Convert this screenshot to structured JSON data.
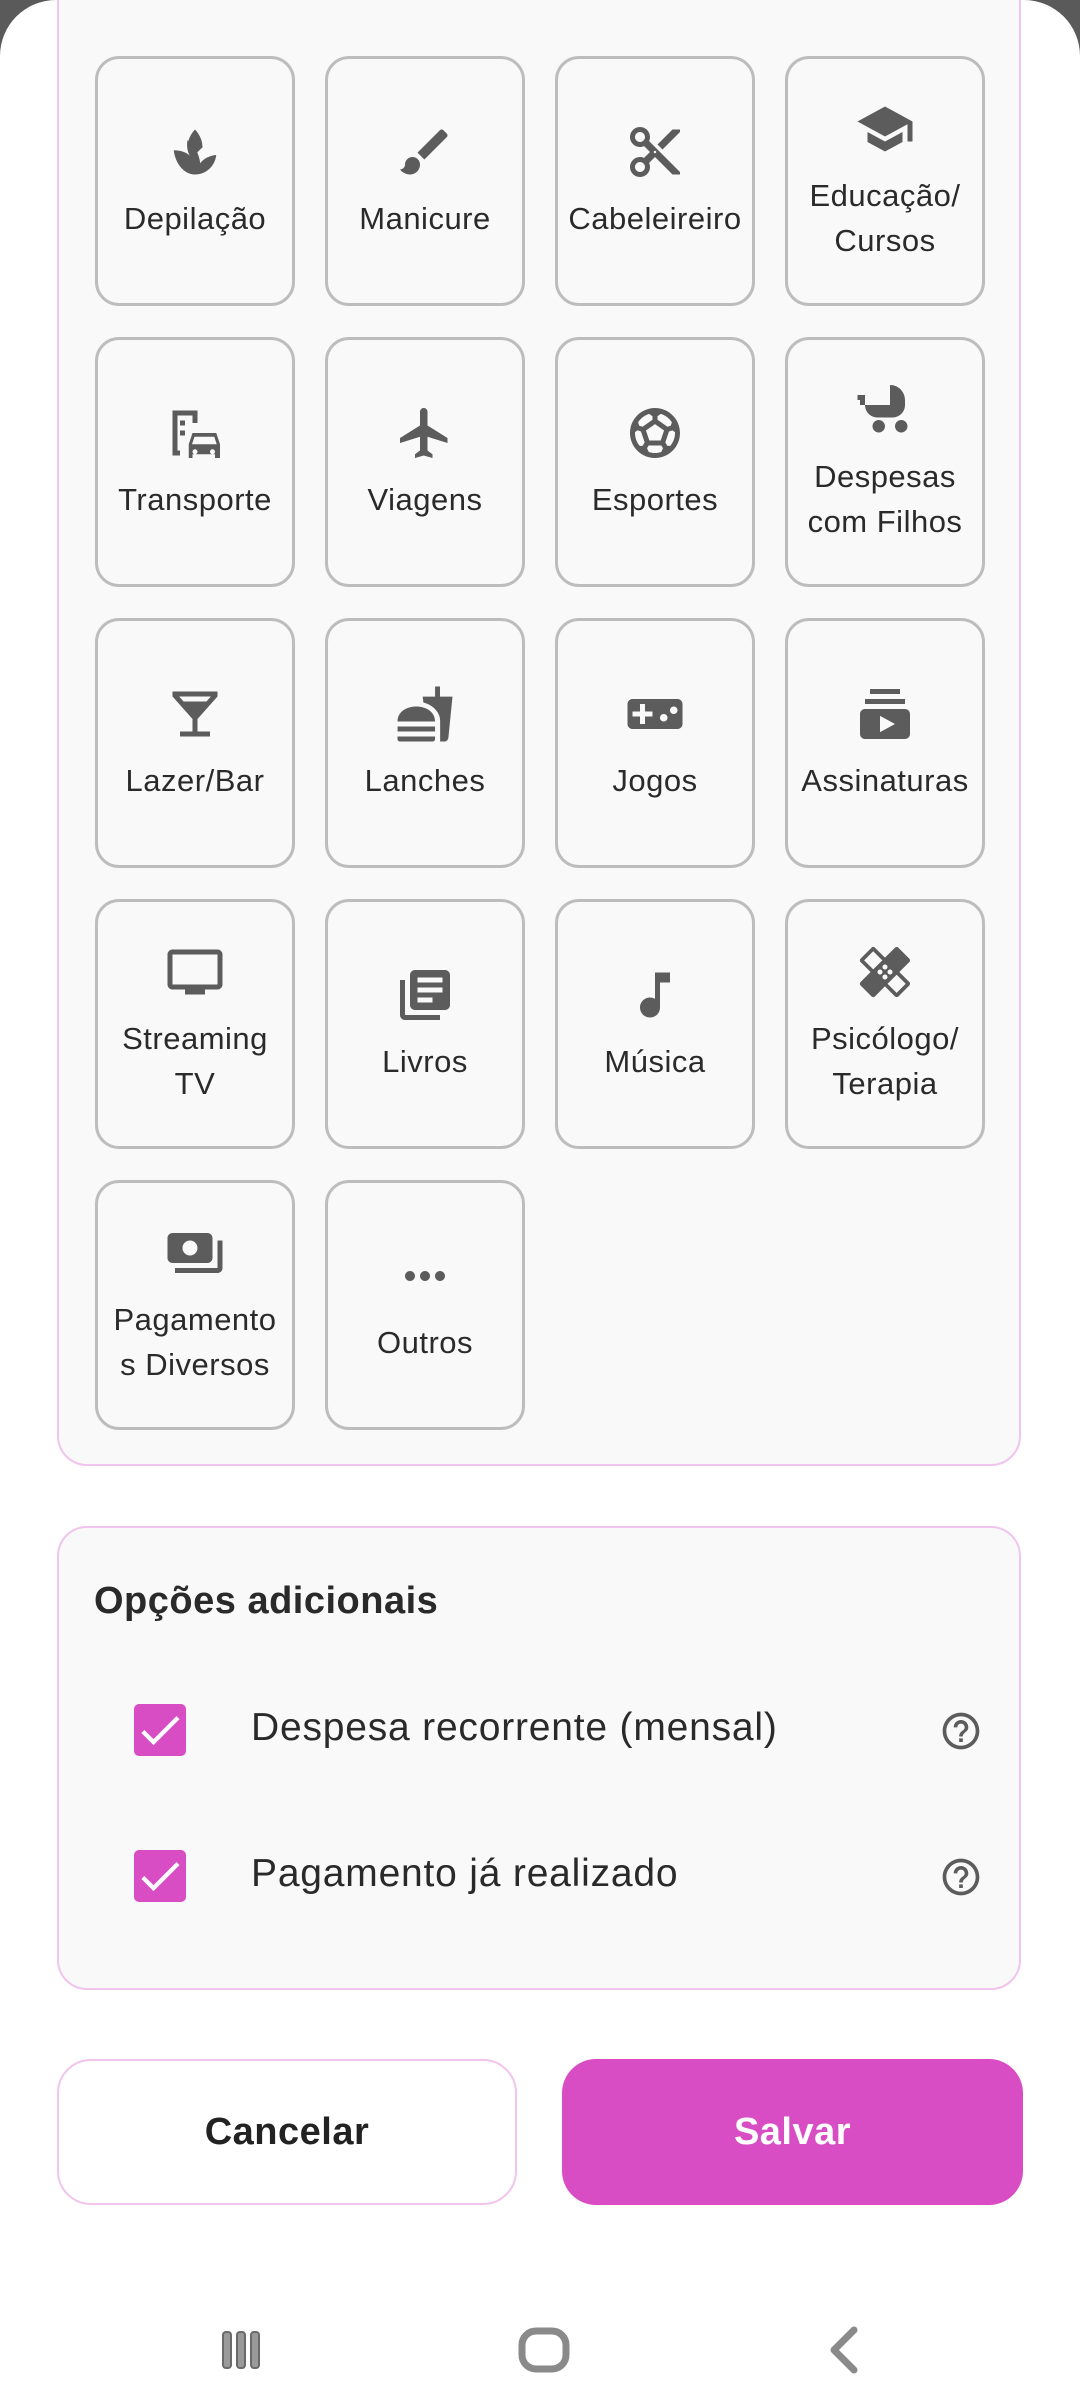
{
  "categories": [
    {
      "label": "Depilação",
      "icon": "spa-icon"
    },
    {
      "label": "Manicure",
      "icon": "brush-icon"
    },
    {
      "label": "Cabeleireiro",
      "icon": "scissors-icon"
    },
    {
      "label": "Educação/\nCursos",
      "icon": "school-icon"
    },
    {
      "label": "Transporte",
      "icon": "transport-icon"
    },
    {
      "label": "Viagens",
      "icon": "airplane-icon"
    },
    {
      "label": "Esportes",
      "icon": "soccer-ball-icon"
    },
    {
      "label": "Despesas\ncom Filhos",
      "icon": "stroller-icon"
    },
    {
      "label": "Lazer/Bar",
      "icon": "cocktail-icon"
    },
    {
      "label": "Lanches",
      "icon": "fastfood-icon"
    },
    {
      "label": "Jogos",
      "icon": "gamepad-icon"
    },
    {
      "label": "Assinaturas",
      "icon": "subscriptions-icon"
    },
    {
      "label": "Streaming\nTV",
      "icon": "tv-icon"
    },
    {
      "label": "Livros",
      "icon": "library-books-icon"
    },
    {
      "label": "Música",
      "icon": "music-note-icon"
    },
    {
      "label": "Psicólogo/\nTerapia",
      "icon": "healing-icon"
    },
    {
      "label": "Pagamento\ns Diversos",
      "icon": "payments-icon"
    },
    {
      "label": "Outros",
      "icon": "more-horiz-icon"
    }
  ],
  "options": {
    "title": "Opções adicionais",
    "items": [
      {
        "label": "Despesa recorrente (mensal)",
        "checked": true
      },
      {
        "label": "Pagamento já realizado",
        "checked": true
      }
    ]
  },
  "buttons": {
    "cancel": "Cancelar",
    "save": "Salvar"
  },
  "colors": {
    "accent": "#d94dc4",
    "panel_border": "#f0c4ec",
    "tile_border": "#bdbdbd",
    "icon": "#5c5c5c"
  }
}
